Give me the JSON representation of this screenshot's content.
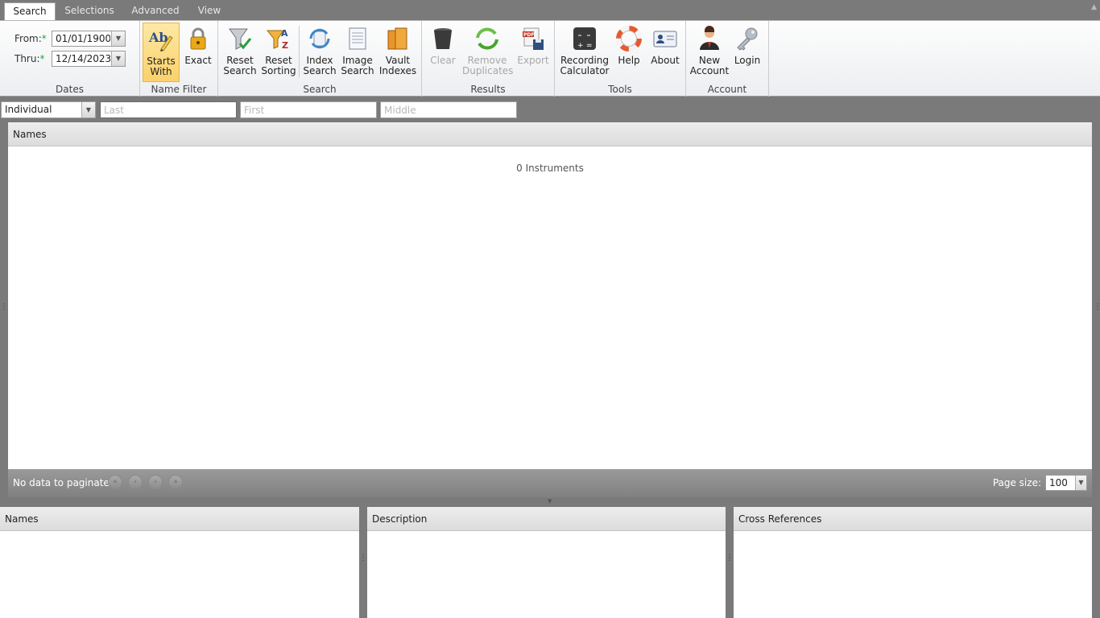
{
  "tabs": [
    "Search",
    "Selections",
    "Advanced",
    "View"
  ],
  "ribbon": {
    "dates": {
      "from_label": "From:",
      "thru_label": "Thru:",
      "required_mark": "*",
      "from_value": "01/01/1900",
      "thru_value": "12/14/2023",
      "group_label": "Dates"
    },
    "name_filter": {
      "starts_with": "Starts\nWith",
      "exact": "Exact",
      "group_label": "Name Filter"
    },
    "search": {
      "reset_search": "Reset\nSearch",
      "reset_sorting": "Reset\nSorting",
      "index_search": "Index\nSearch",
      "image_search": "Image\nSearch",
      "vault_indexes": "Vault\nIndexes",
      "group_label": "Search"
    },
    "results": {
      "clear": "Clear",
      "remove_duplicates": "Remove\nDuplicates",
      "export": "Export",
      "group_label": "Results"
    },
    "tools": {
      "recording_calculator": "Recording\nCalculator",
      "help": "Help",
      "about": "About",
      "group_label": "Tools"
    },
    "account": {
      "new_account": "New\nAccount",
      "login": "Login",
      "group_label": "Account"
    }
  },
  "filter": {
    "type_value": "Individual",
    "last_placeholder": "Last",
    "first_placeholder": "First",
    "middle_placeholder": "Middle"
  },
  "main_grid": {
    "header": "Names",
    "empty_message": "0 Instruments",
    "pager_message": "No data to paginate",
    "page_size_label": "Page size:",
    "page_size_value": "100"
  },
  "panes": {
    "names": "Names",
    "description": "Description",
    "cross_references": "Cross References"
  },
  "icons": {
    "abc_pencil": "starts-with-icon",
    "lock": "lock-icon",
    "funnel_check": "reset-search-icon",
    "funnel_az": "reset-sorting-icon",
    "refresh_doc": "index-search-icon",
    "document": "image-search-icon",
    "books": "vault-indexes-icon",
    "trash": "trash-icon",
    "green_refresh": "remove-duplicates-icon",
    "pdf_save": "export-pdf-icon",
    "calculator": "calculator-icon",
    "lifebuoy": "help-icon",
    "id_card": "about-icon",
    "user": "new-account-icon",
    "key": "key-icon"
  },
  "colors": {
    "active_tab_bg": "#ffffff",
    "active_button_bg": "#fbd16a",
    "chrome_gray": "#7a7a7a",
    "required_green": "#2aa14a"
  }
}
